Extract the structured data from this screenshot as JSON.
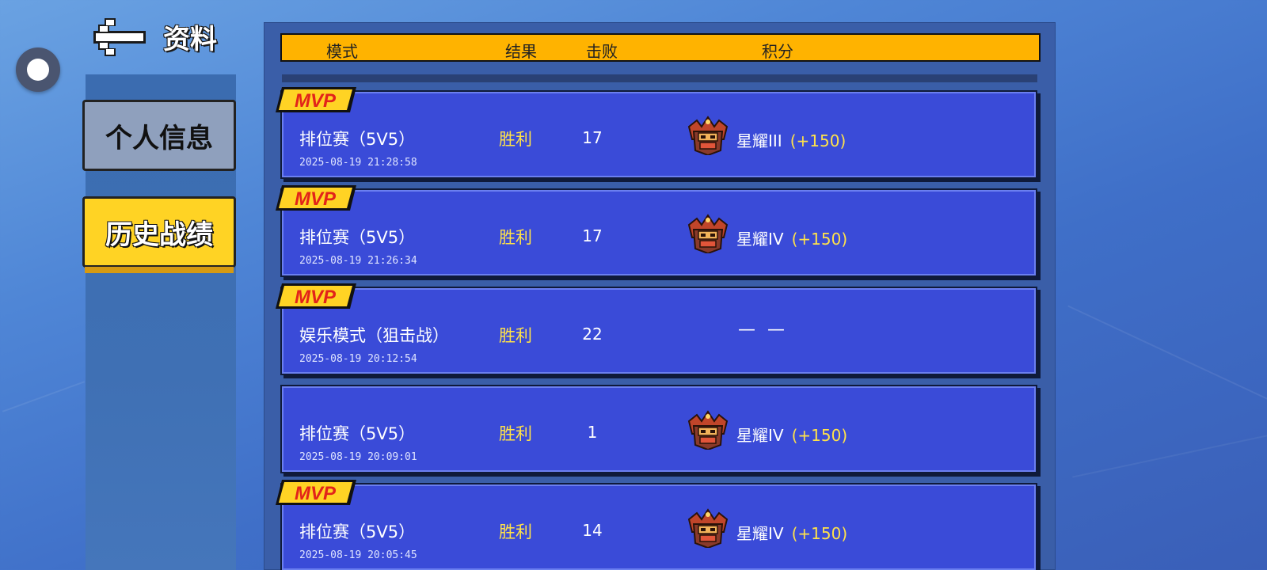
{
  "header": {
    "title": "资料",
    "back_icon": "back-arrow-icon"
  },
  "sidebar": {
    "items": [
      {
        "label": "个人信息",
        "active": false
      },
      {
        "label": "历史战绩",
        "active": true
      }
    ]
  },
  "table": {
    "columns": [
      "模式",
      "结果",
      "击败",
      "积分"
    ],
    "mvp_label": "MVP",
    "rows": [
      {
        "mvp": true,
        "mode": "排位赛（5V5）",
        "time": "2025-08-19 21:28:58",
        "result": "胜利",
        "kills": "17",
        "rank": "星耀III",
        "points": "(+150)"
      },
      {
        "mvp": true,
        "mode": "排位赛（5V5）",
        "time": "2025-08-19 21:26:34",
        "result": "胜利",
        "kills": "17",
        "rank": "星耀IV",
        "points": "(+150)"
      },
      {
        "mvp": true,
        "mode": "娱乐模式（狙击战）",
        "time": "2025-08-19 20:12:54",
        "result": "胜利",
        "kills": "22",
        "no_score": "— —"
      },
      {
        "mvp": false,
        "mode": "排位赛（5V5）",
        "time": "2025-08-19 20:09:01",
        "result": "胜利",
        "kills": "1",
        "rank": "星耀IV",
        "points": "(+150)"
      },
      {
        "mvp": true,
        "mode": "排位赛（5V5）",
        "time": "2025-08-19 20:05:45",
        "result": "胜利",
        "kills": "14",
        "rank": "星耀IV",
        "points": "(+150)"
      }
    ]
  },
  "colors": {
    "header_bar": "#ffb300",
    "row_bg": "#3a4bd8",
    "win_text": "#ffe24a",
    "active_tab": "#ffd324",
    "inactive_tab": "#8fa0bd"
  }
}
